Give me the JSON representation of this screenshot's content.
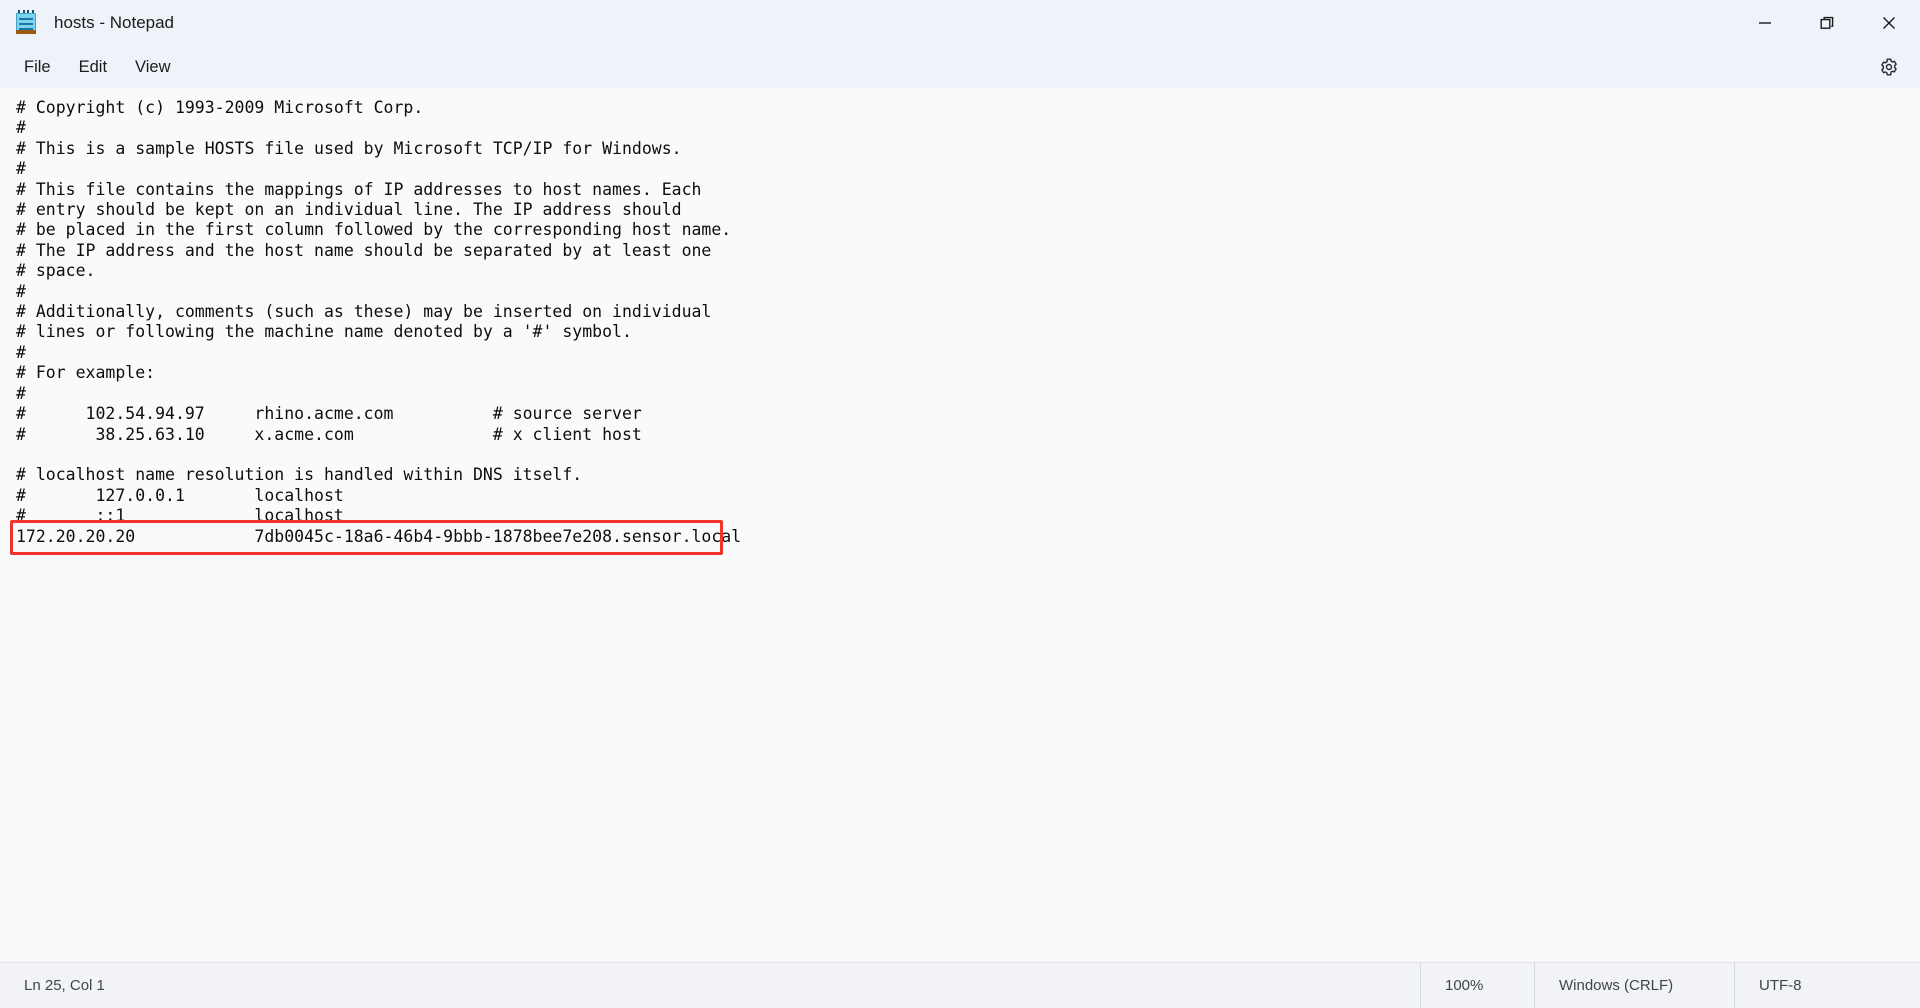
{
  "window": {
    "title": "hosts - Notepad",
    "icon": "notepad-icon",
    "controls": {
      "minimize": "minimize-icon",
      "maximize": "restore-icon",
      "close": "close-icon"
    }
  },
  "menubar": {
    "items": [
      {
        "label": "File"
      },
      {
        "label": "Edit"
      },
      {
        "label": "View"
      }
    ],
    "settings_icon": "gear-icon"
  },
  "editor": {
    "content": "# Copyright (c) 1993-2009 Microsoft Corp.\n#\n# This is a sample HOSTS file used by Microsoft TCP/IP for Windows.\n#\n# This file contains the mappings of IP addresses to host names. Each\n# entry should be kept on an individual line. The IP address should\n# be placed in the first column followed by the corresponding host name.\n# The IP address and the host name should be separated by at least one\n# space.\n#\n# Additionally, comments (such as these) may be inserted on individual\n# lines or following the machine name denoted by a '#' symbol.\n#\n# For example:\n#\n#      102.54.94.97     rhino.acme.com          # source server\n#       38.25.63.10     x.acme.com              # x client host\n\n# localhost name resolution is handled within DNS itself.\n#\t127.0.0.1       localhost\n#\t::1             localhost\n172.20.20.20            7db0045c-18a6-46b4-9bbb-1878bee7e208.sensor.local",
    "highlighted_entry": {
      "ip": "172.20.20.20",
      "hostname": "7db0045c-18a6-46b4-9bbb-1878bee7e208.sensor.local",
      "highlight_color": "#f0352f"
    }
  },
  "statusbar": {
    "cursor_position": "Ln 25, Col 1",
    "zoom": "100%",
    "line_ending": "Windows (CRLF)",
    "encoding": "UTF-8"
  },
  "colors": {
    "chrome_background": "#eef2f9",
    "editor_background": "#fafafa",
    "statusbar_background": "#f1f3f6",
    "accent_red": "#f0352f"
  }
}
